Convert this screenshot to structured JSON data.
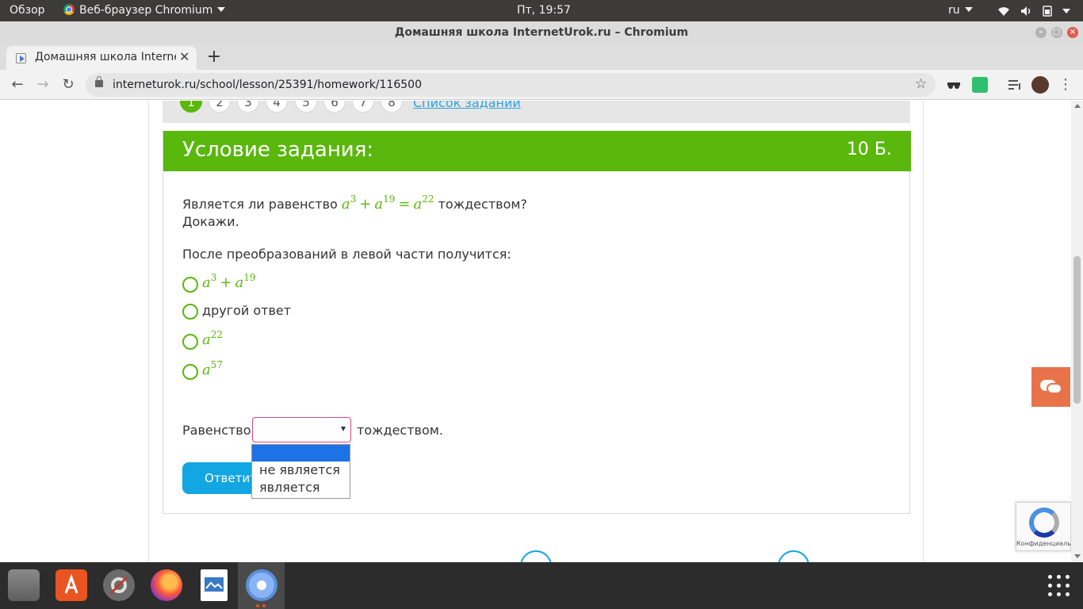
{
  "topbar": {
    "activities": "Обзор",
    "app_menu": "Веб-браузер Chromium",
    "clock": "Пт, 19:57",
    "keyboard_lang": "ru"
  },
  "window": {
    "title": "Домашняя школа InternetUrok.ru – Chromium"
  },
  "tab": {
    "title": "Домашняя школа InternetUrok.ru"
  },
  "toolbar": {
    "url": "interneturok.ru/school/lesson/25391/homework/116500"
  },
  "task_nav": {
    "numbers": [
      "1",
      "2",
      "3",
      "4",
      "5",
      "6",
      "7",
      "8"
    ],
    "active": "1",
    "task_list_link": "Список заданий"
  },
  "task": {
    "header_title": "Условие задания:",
    "points": "10 Б.",
    "question_prefix": "Является ли равенство",
    "question_suffix": "тождеством?",
    "question_line2": "Докажи.",
    "sub_question": "После преобразований в левой части получится:",
    "options": {
      "opt1": "a³ + a¹⁹",
      "opt2": "другой ответ",
      "opt3": "a²²",
      "opt4": "a⁵⁷"
    },
    "equality_label": "Равенство",
    "equality_suffix": "тождеством.",
    "answer_button": "Ответить",
    "dropdown_options": [
      "",
      "не является",
      "является"
    ]
  },
  "recaptcha": {
    "text": "Конфиденциальность"
  },
  "colors": {
    "accent_green": "#5ab70c",
    "link_blue": "#2ea4d8",
    "button_blue": "#12a6e2",
    "select_border": "#e0467c",
    "chat_orange": "#e8734a"
  }
}
